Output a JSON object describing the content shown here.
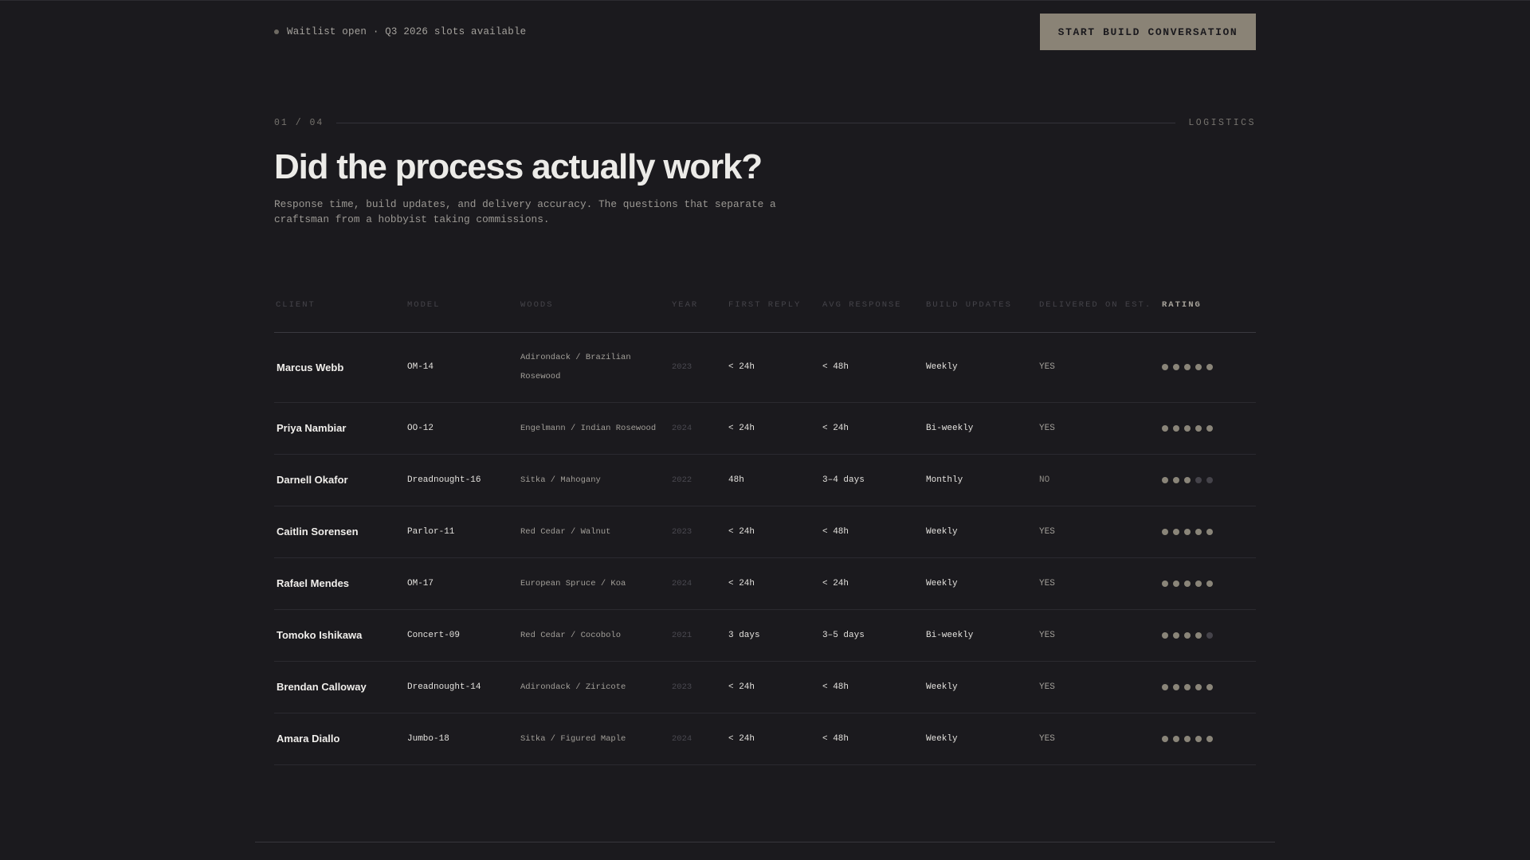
{
  "header": {
    "status_text": "Waitlist open · Q3 2026 slots available",
    "cta_label": "START BUILD CONVERSATION"
  },
  "section": {
    "index": "01 / 04",
    "category": "LOGISTICS",
    "title": "Did the process actually work?",
    "subtitle": "Response time, build updates, and delivery accuracy. The questions that separate a craftsman from a hobbyist taking commissions."
  },
  "table": {
    "columns": [
      "CLIENT",
      "MODEL",
      "WOODS",
      "YEAR",
      "FIRST REPLY",
      "AVG RESPONSE",
      "BUILD UPDATES",
      "DELIVERED ON EST.",
      "RATING"
    ],
    "rows": [
      {
        "client": "Marcus Webb",
        "model": "OM-14",
        "woods": "Adirondack / Brazilian Rosewood",
        "year": "2023",
        "first_reply": "< 24h",
        "avg_response": "< 48h",
        "updates": "Weekly",
        "delivered": "YES",
        "rating": 5
      },
      {
        "client": "Priya Nambiar",
        "model": "OO-12",
        "woods": "Engelmann / Indian Rosewood",
        "year": "2024",
        "first_reply": "< 24h",
        "avg_response": "< 24h",
        "updates": "Bi-weekly",
        "delivered": "YES",
        "rating": 5
      },
      {
        "client": "Darnell Okafor",
        "model": "Dreadnought-16",
        "woods": "Sitka / Mahogany",
        "year": "2022",
        "first_reply": "48h",
        "avg_response": "3–4 days",
        "updates": "Monthly",
        "delivered": "NO",
        "rating": 3
      },
      {
        "client": "Caitlin Sorensen",
        "model": "Parlor-11",
        "woods": "Red Cedar / Walnut",
        "year": "2023",
        "first_reply": "< 24h",
        "avg_response": "< 48h",
        "updates": "Weekly",
        "delivered": "YES",
        "rating": 5
      },
      {
        "client": "Rafael Mendes",
        "model": "OM-17",
        "woods": "European Spruce / Koa",
        "year": "2024",
        "first_reply": "< 24h",
        "avg_response": "< 24h",
        "updates": "Weekly",
        "delivered": "YES",
        "rating": 5
      },
      {
        "client": "Tomoko Ishikawa",
        "model": "Concert-09",
        "woods": "Red Cedar / Cocobolo",
        "year": "2021",
        "first_reply": "3 days",
        "avg_response": "3–5 days",
        "updates": "Bi-weekly",
        "delivered": "YES",
        "rating": 4
      },
      {
        "client": "Brendan Calloway",
        "model": "Dreadnought-14",
        "woods": "Adirondack / Ziricote",
        "year": "2023",
        "first_reply": "< 24h",
        "avg_response": "< 48h",
        "updates": "Weekly",
        "delivered": "YES",
        "rating": 5
      },
      {
        "client": "Amara Diallo",
        "model": "Jumbo-18",
        "woods": "Sitka / Figured Maple",
        "year": "2024",
        "first_reply": "< 24h",
        "avg_response": "< 48h",
        "updates": "Weekly",
        "delivered": "YES",
        "rating": 5
      }
    ],
    "rating_max": 5
  },
  "colors": {
    "background": "#1b1a1e",
    "accent": "#8a8376",
    "dot_on": "#8a8579",
    "dot_off": "#45434a"
  }
}
